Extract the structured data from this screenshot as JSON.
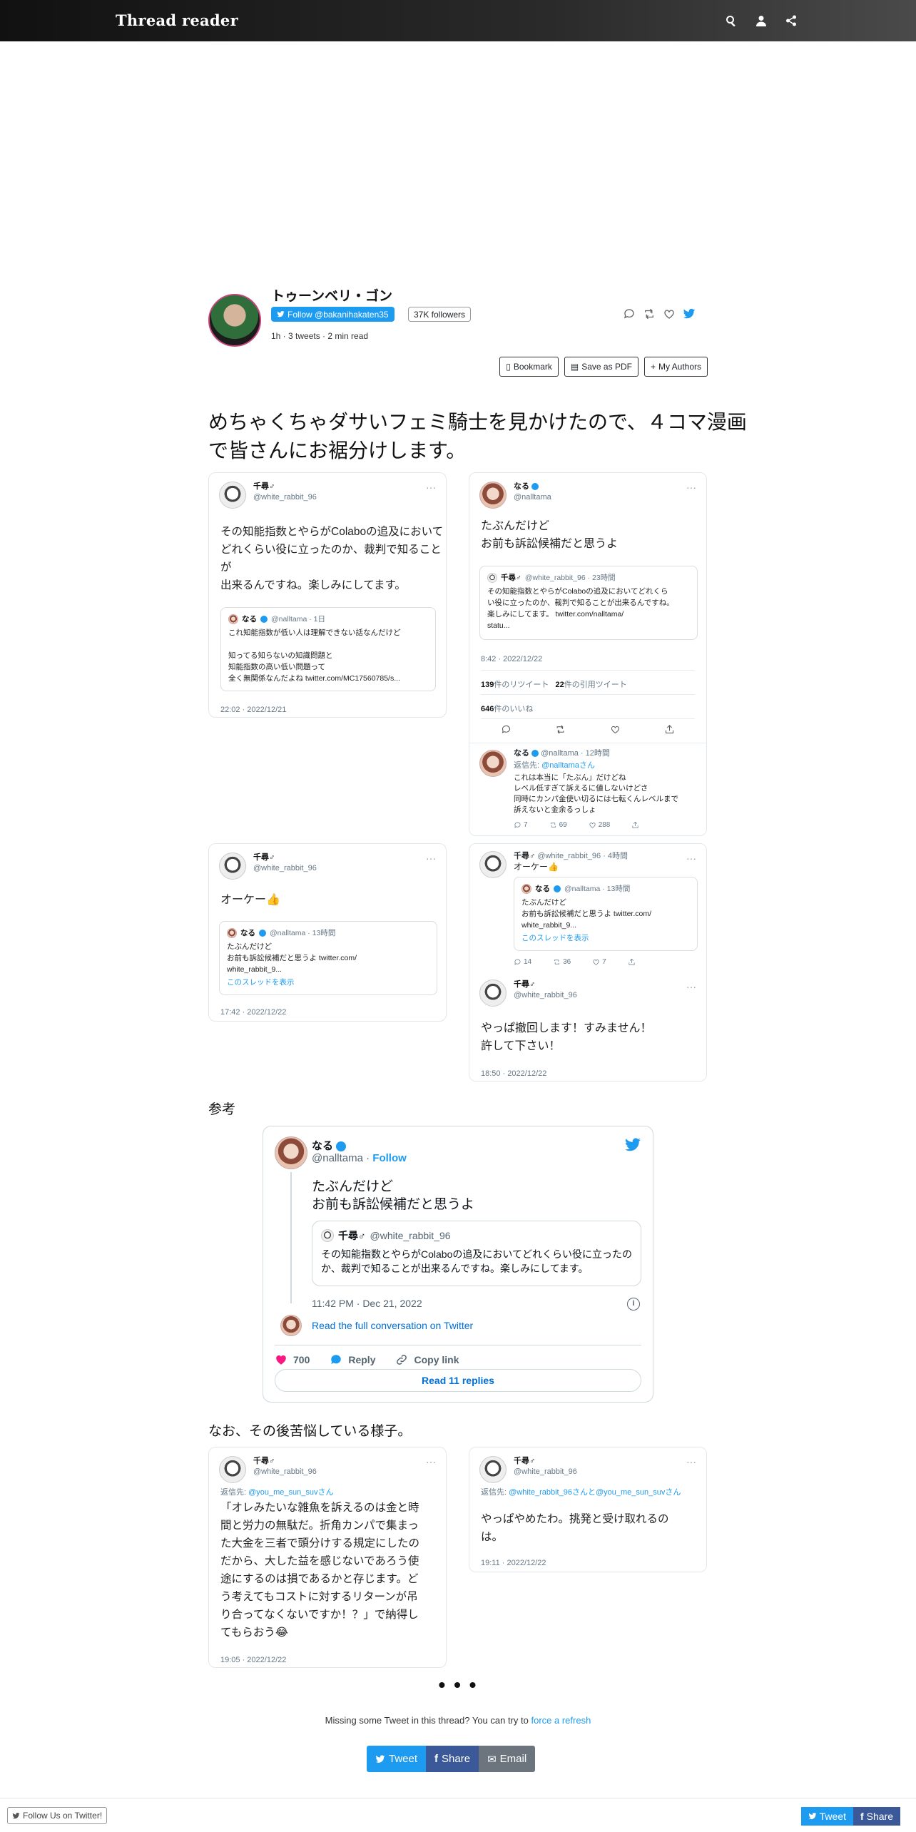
{
  "navbar": {
    "logo": "Thread reader",
    "icons": [
      "search-icon",
      "user-icon",
      "share-icon"
    ]
  },
  "author": {
    "name": "トゥーンベリ・ゴン",
    "follow_label": "Follow @bakanihakaten35",
    "followers": "37K followers",
    "meta": "1h · 3 tweets · 2 min read",
    "actions": {
      "bookmark": "Bookmark",
      "pdf": "Save as PDF",
      "authors": "My Authors"
    }
  },
  "thread_title": "めちゃくちゃダサいフェミ騎士を見かけたので、４コマ漫画で皆さんにお裾分けします。",
  "tweets": {
    "t1": {
      "name": "千尋♂",
      "handle": "@white_rabbit_96",
      "body": "その知能指数とやらがColaboの追及において\nどれくらい役に立ったのか、裁判で知ることが\n出来るんですね。楽しみにしてます。",
      "quote": {
        "name": "なる",
        "meta": "@nalltama · 1日",
        "text": "これ知能指数が低い人は理解できない話なんだけど\n\n知ってる知らないの知識問題と\n知能指数の高い低い問題って\n全く無関係なんだよね twitter.com/MC17560785/s..."
      },
      "time": "22:02 · 2022/12/21"
    },
    "t2": {
      "name": "なる",
      "handle": "@nalltama",
      "body": "たぶんだけど\nお前も訴訟候補だと思うよ",
      "quote": {
        "name": "千尋♂",
        "meta": "@white_rabbit_96 · 23時間",
        "text": "その知能指数とやらがColaboの追及においてどれくら\nい役に立ったのか、裁判で知ることが出来るんですね。\n楽しみにしてます。 twitter.com/nalltama/\nstatu..."
      },
      "time": "8:42 · 2022/12/22",
      "retweets": "139",
      "retweets_label": "件のリツイート",
      "quotes": "22",
      "quotes_label": "件の引用ツイート",
      "likes": "646",
      "likes_label": "件のいいね",
      "reply": {
        "name": "なる",
        "meta": "@nalltama · 12時間",
        "reply_to_label": "返信先:",
        "reply_to": "@nalltamaさん",
        "text": "これは本当に「たぶん」だけどね\nレベル低すぎて訴えるに値しないけどさ\n同時にカンパ金使い切るには七転くんレベルまで\n訴えないと金余るっしょ",
        "counts": {
          "replies": "7",
          "retweets": "69",
          "likes": "288"
        }
      }
    },
    "t3": {
      "name": "千尋♂",
      "handle": "@white_rabbit_96",
      "body": "オーケー👍",
      "quote": {
        "name": "なる",
        "meta": "@nalltama · 13時間",
        "text": "たぶんだけど\nお前も訴訟候補だと思うよ twitter.com/\nwhite_rabbit_9...",
        "link": "このスレッドを表示"
      },
      "time": "17:42 · 2022/12/22"
    },
    "t4": {
      "top": {
        "name": "千尋♂",
        "meta": "@white_rabbit_96 · 4時間",
        "text": "オーケー👍",
        "quote": {
          "name": "なる",
          "meta": "@nalltama · 13時間",
          "text": "たぶんだけど\nお前も訴訟候補だと思うよ twitter.com/\nwhite_rabbit_9...",
          "link": "このスレッドを表示"
        },
        "counts": {
          "replies": "14",
          "retweets": "36",
          "likes": "7"
        }
      },
      "name": "千尋♂",
      "handle": "@white_rabbit_96",
      "body": "やっぱ撤回します！すみません！\n許して下さい！",
      "time": "18:50 · 2022/12/22"
    },
    "t5": {
      "name": "千尋♂",
      "handle": "@white_rabbit_96",
      "reply_to_label": "返信先:",
      "reply_to": "@you_me_sun_suvさん",
      "body": "「オレみたいな雑魚を訴えるのは金と時\n間と労力の無駄だ。折角カンパで集まっ\nた大金を三者で頭分けする規定にしたの\nだから、大した益を感じないであろう使\n途にするのは損であるかと存じます。ど\nう考えてもコストに対するリターンが吊\nり合ってなくないですか！？」で納得し\nてもらおう😂",
      "time": "19:05 · 2022/12/22"
    },
    "t6": {
      "name": "千尋♂",
      "handle": "@white_rabbit_96",
      "reply_to_label": "返信先:",
      "reply_to": "@white_rabbit_96さんと@you_me_sun_suvさん",
      "body": "やっぱやめたわ。挑発と受け取れるの\nは。",
      "time": "19:11 · 2022/12/22"
    }
  },
  "section_reference": "参考",
  "section_after": "なお、その後苦悩している様子。",
  "embed": {
    "name": "なる",
    "handle": "@nalltama",
    "follow": "Follow",
    "text": "たぶんだけど\nお前も訴訟候補だと思うよ",
    "quote_name": "千尋♂",
    "quote_handle": "@white_rabbit_96",
    "quote_text": "その知能指数とやらがColaboの追及においてどれくらい役に立ったのか、裁判で知ることが出来るんですね。楽しみにしてます。",
    "time": "11:42 PM · Dec 21, 2022",
    "conversation": "Read the full conversation on Twitter",
    "likes": "700",
    "reply": "Reply",
    "copy": "Copy link",
    "read_replies": "Read 11 replies"
  },
  "footer": {
    "ellipsis": "• • •",
    "missing": "Missing some Tweet in this thread? You can try to",
    "refresh": "force a refresh",
    "tweet": "Tweet",
    "share": "Share",
    "email": "Email",
    "follow_us": "Follow Us on Twitter!"
  },
  "colors": {
    "accent": "#1d9bf0",
    "facebook": "#3b5998",
    "email": "#6c757d",
    "like": "#f91880"
  }
}
